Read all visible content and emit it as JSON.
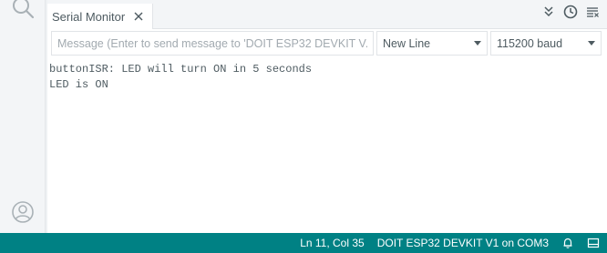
{
  "tab": {
    "title": "Serial Monitor",
    "close_icon": "close-icon"
  },
  "tab_actions": {
    "toggle_autoscroll_icon": "chevrons-down-icon",
    "timestamp_icon": "clock-icon",
    "clear_output_icon": "clear-lines-icon"
  },
  "toolbar": {
    "message_placeholder": "Message (Enter to send message to 'DOIT ESP32 DEVKIT V...",
    "line_ending": "New Line",
    "baud_rate": "115200 baud"
  },
  "output": {
    "lines": [
      "buttonISR: LED will turn ON in 5 seconds",
      "LED is ON"
    ]
  },
  "activity_bar": {
    "search_icon": "search-icon",
    "account_icon": "account-icon"
  },
  "statusbar": {
    "position": "Ln 11, Col 35",
    "board": "DOIT ESP32 DEVKIT V1 on COM3",
    "notifications_icon": "bell-icon",
    "panel_toggle_icon": "panel-icon"
  },
  "colors": {
    "status_bar": "#008184",
    "text": "#4e5b61",
    "border": "#e1e4e7"
  }
}
